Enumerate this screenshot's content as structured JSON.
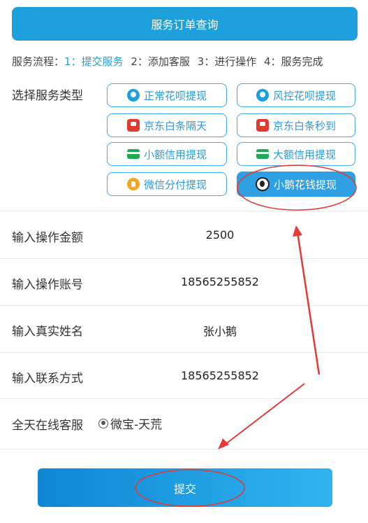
{
  "header": {
    "title": "服务订单查询"
  },
  "flow": {
    "label": "服务流程：",
    "steps": [
      "1：提交服务",
      "2：添加客服",
      "3：进行操作",
      "4：服务完成"
    ]
  },
  "service_type": {
    "label": "选择服务类型",
    "options": [
      {
        "label": "正常花呗提现",
        "icon": "huabei-icon"
      },
      {
        "label": "风控花呗提现",
        "icon": "huabei-icon"
      },
      {
        "label": "京东白条隔天",
        "icon": "jd-icon"
      },
      {
        "label": "京东白条秒到",
        "icon": "jd-icon"
      },
      {
        "label": "小额信用提现",
        "icon": "card-icon"
      },
      {
        "label": "大额信用提现",
        "icon": "card-icon"
      },
      {
        "label": "微信分付提现",
        "icon": "wechat-fenfu-icon"
      },
      {
        "label": "小鹅花钱提现",
        "icon": "xiaoe-icon"
      }
    ],
    "selected": "小鹅花钱提现"
  },
  "form": {
    "amount": {
      "label": "输入操作金额",
      "value": "2500"
    },
    "account": {
      "label": "输入操作账号",
      "value": "18565255852"
    },
    "name": {
      "label": "输入真实姓名",
      "value": "张小鹅"
    },
    "contact": {
      "label": "输入联系方式",
      "value": "18565255852"
    }
  },
  "support": {
    "label": "全天在线客服",
    "option": "微宝-天荒"
  },
  "submit": {
    "label": "提交"
  },
  "colors": {
    "accent": "#1ea0dc",
    "annotation": "#e53935"
  }
}
